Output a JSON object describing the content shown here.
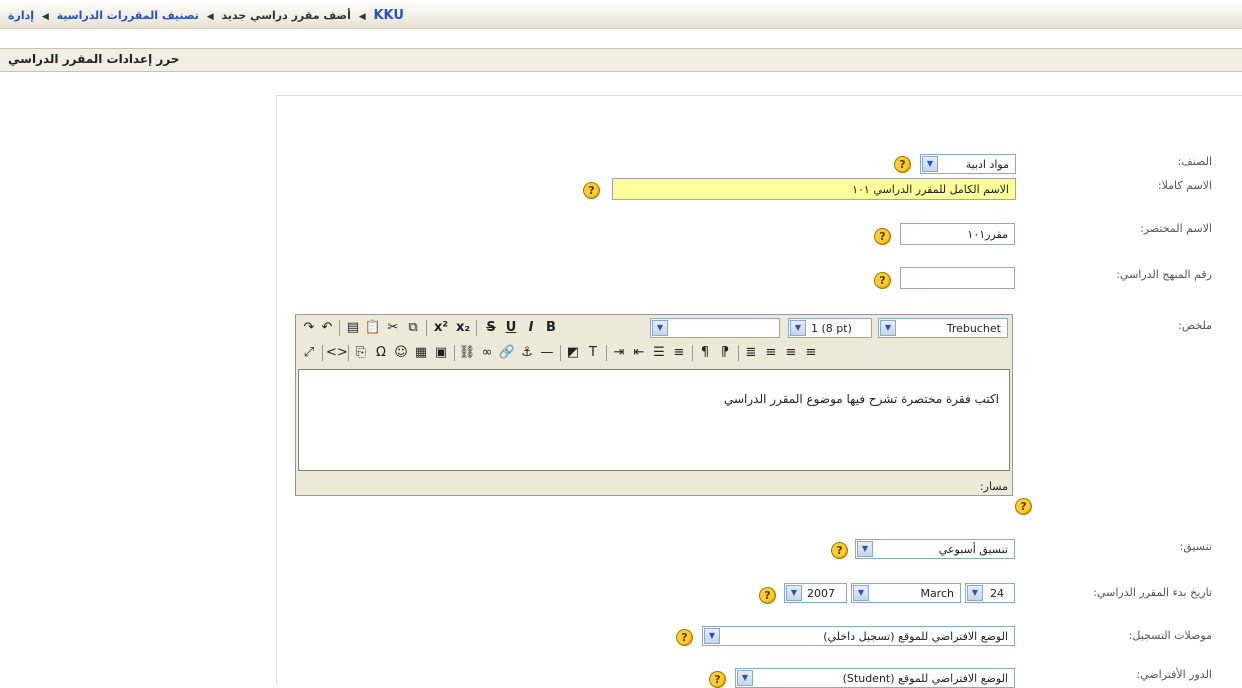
{
  "breadcrumb": {
    "home": "KKU",
    "admin": "إدارة",
    "categories": "تصنيف المقررات الدراسية",
    "current": "أضف مقرر دراسي جديد"
  },
  "heading": "حرر إعدادات المقرر الدراسي",
  "form": {
    "category": {
      "label": "الصنف:",
      "value": "مواد ادبية"
    },
    "fullname": {
      "label": "الاسم كاملا:",
      "value": "الاسم الكامل للمقرر الدراسي ١٠١"
    },
    "shortname": {
      "label": "الاسم المختصر:",
      "value": "مقرر١٠١"
    },
    "idnumber": {
      "label": "رقم المنهج الدراسي:",
      "value": ""
    },
    "summary": {
      "label": "ملخص:",
      "font": "Trebuchet",
      "size": "1 (8 pt)",
      "style": "",
      "text": "اكتب فقرة مختصرة تشرح فيها موضوع المقرر الدراسي",
      "path_label": "مسار:"
    },
    "format": {
      "label": "تنسيق:",
      "value": "تنسيق أسبوعي"
    },
    "startdate": {
      "label": "تاريخ بدء المقرر الدراسي:",
      "day": "24",
      "month": "March",
      "year": "2007"
    },
    "enrol": {
      "label": "موصلات التسجيل:",
      "value": "الوضع الافتراضي للموقع (تسجيل داخلي)"
    },
    "defaultrole": {
      "label": "الدور الأفتراضي:",
      "value": "الوضع الافتراضي للموقع (Student)"
    }
  },
  "help_glyph": "?",
  "colors": {
    "accent_link": "#2a52be",
    "help": "#ffcc33",
    "highlight": "#ffff99"
  }
}
